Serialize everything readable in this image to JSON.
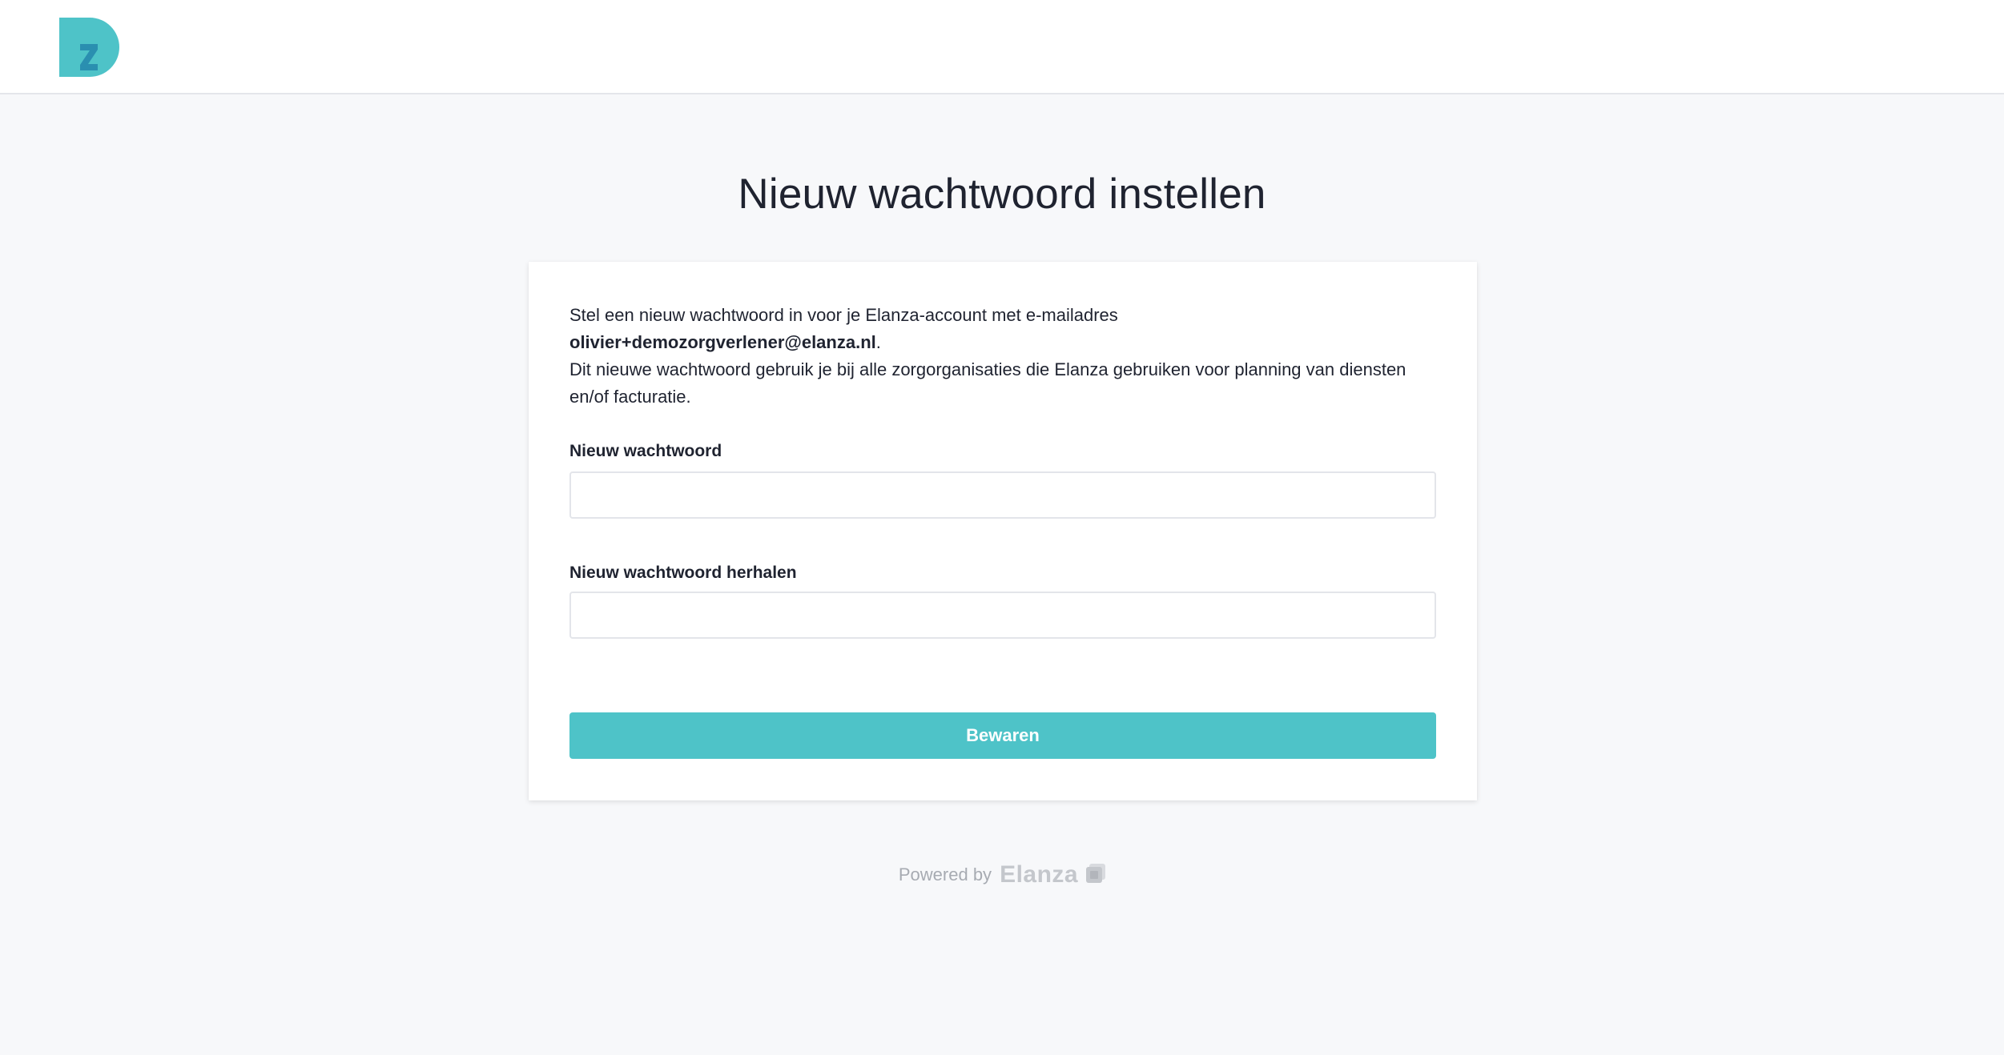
{
  "header": {
    "logo_letters": "Dz",
    "logo_color": "#4ec3c8",
    "logo_accent_color": "#2a8fb0"
  },
  "page": {
    "title": "Nieuw wachtwoord instellen"
  },
  "form": {
    "intro_line1": "Stel een nieuw wachtwoord in voor je Elanza-account met e-mailadres",
    "email": "olivier+demozorgverlener@elanza.nl",
    "email_suffix": ".",
    "intro_line2": "Dit nieuwe wachtwoord gebruik je bij alle zorgorganisaties die Elanza gebruiken voor planning van diensten en/of facturatie.",
    "new_password_label": "Nieuw wachtwoord",
    "new_password_value": "",
    "repeat_password_label": "Nieuw wachtwoord herhalen",
    "repeat_password_value": "",
    "save_label": "Bewaren",
    "accent_color": "#4ec3c8"
  },
  "footer": {
    "powered_by": "Powered by",
    "brand": "Elanza",
    "brand_icon": "elanza-logo-icon"
  }
}
